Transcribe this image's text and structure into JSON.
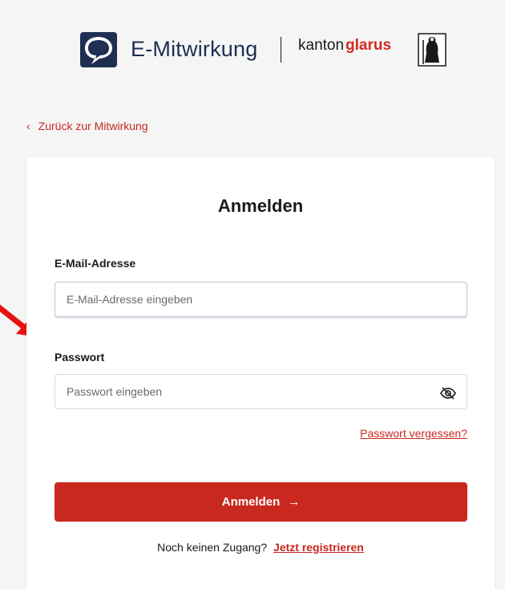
{
  "header": {
    "app_name": "E-Mitwirkung",
    "partner_prefix": "kanton",
    "partner_name": "glarus"
  },
  "back_link": {
    "label": "Zurück zur Mitwirkung"
  },
  "login": {
    "title": "Anmelden",
    "email": {
      "label": "E-Mail-Adresse",
      "placeholder": "E-Mail-Adresse eingeben",
      "value": ""
    },
    "password": {
      "label": "Passwort",
      "placeholder": "Passwort eingeben",
      "value": ""
    },
    "forgot_label": "Passwort vergessen?",
    "submit_label": "Anmelden",
    "register_prompt": "Noch keinen Zugang?",
    "register_link": "Jetzt registrieren"
  },
  "colors": {
    "accent": "#c9281f",
    "brand_dark": "#1e2f52",
    "background": "#f5f5f5",
    "card": "#ffffff"
  },
  "icons": [
    "speech-bubble-logo-icon",
    "crest-icon",
    "chevron-left-icon",
    "eye-slash-icon",
    "arrow-right-icon",
    "annotation-arrow-icon"
  ]
}
